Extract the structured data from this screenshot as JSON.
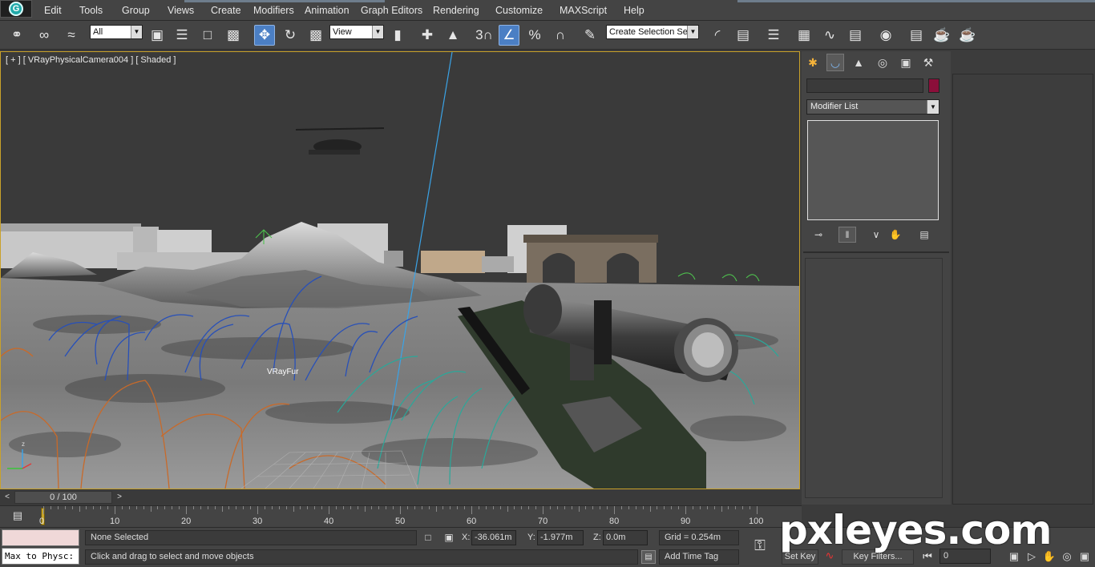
{
  "menu": {
    "items": [
      "Edit",
      "Tools",
      "Group",
      "Views",
      "Create",
      "Modifiers",
      "Animation",
      "Graph Editors",
      "Rendering",
      "Customize",
      "MAXScript",
      "Help"
    ]
  },
  "toolbar": {
    "selection_filter": "All",
    "reference_coord": "View",
    "snap_angle_label": "3",
    "named_selection_placeholder": "Create Selection Se",
    "icons": [
      "link-icon",
      "unlink-icon",
      "bind-space-warp-icon",
      "select-object-icon",
      "select-by-name-icon",
      "rect-selection-icon",
      "window-crossing-icon",
      "move-icon",
      "rotate-icon",
      "scale-icon",
      "pivot-icon",
      "manipulate-icon",
      "keyboard-shortcut-icon",
      "snap-3d-icon",
      "angle-snap-icon",
      "percent-snap-icon",
      "spinner-snap-icon",
      "edit-named-selection-icon",
      "mirror-icon",
      "align-icon",
      "layer-manager-icon",
      "graphite-icon",
      "curve-editor-icon",
      "schematic-view-icon",
      "material-editor-icon",
      "render-setup-icon",
      "rendered-frame-icon",
      "render-production-icon"
    ]
  },
  "viewport": {
    "label": "[ + ] [ VRayPhysicalCamera004 ] [ Shaded ]",
    "object_label": "VRayFur"
  },
  "command_panel": {
    "modifier_list": "Modifier List",
    "color_swatch": "#8b0f3a"
  },
  "time_slider": {
    "label": "0 / 100",
    "ticks": [
      "0",
      "10",
      "20",
      "30",
      "40",
      "50",
      "60",
      "70",
      "80",
      "90",
      "100"
    ]
  },
  "status": {
    "listener_text": "Max to Physc:",
    "selection": "None Selected",
    "prompt": "Click and drag to select and move objects",
    "x_label": "X:",
    "x_value": "-36.061m",
    "y_label": "Y:",
    "y_value": "-1.977m",
    "z_label": "Z:",
    "z_value": "0.0m",
    "grid": "Grid = 0.254m",
    "add_time_tag": "Add Time Tag",
    "set_key": "Set Key",
    "key_filters": "Key Filters...",
    "frame": "0"
  },
  "watermark": "pxleyes.com"
}
